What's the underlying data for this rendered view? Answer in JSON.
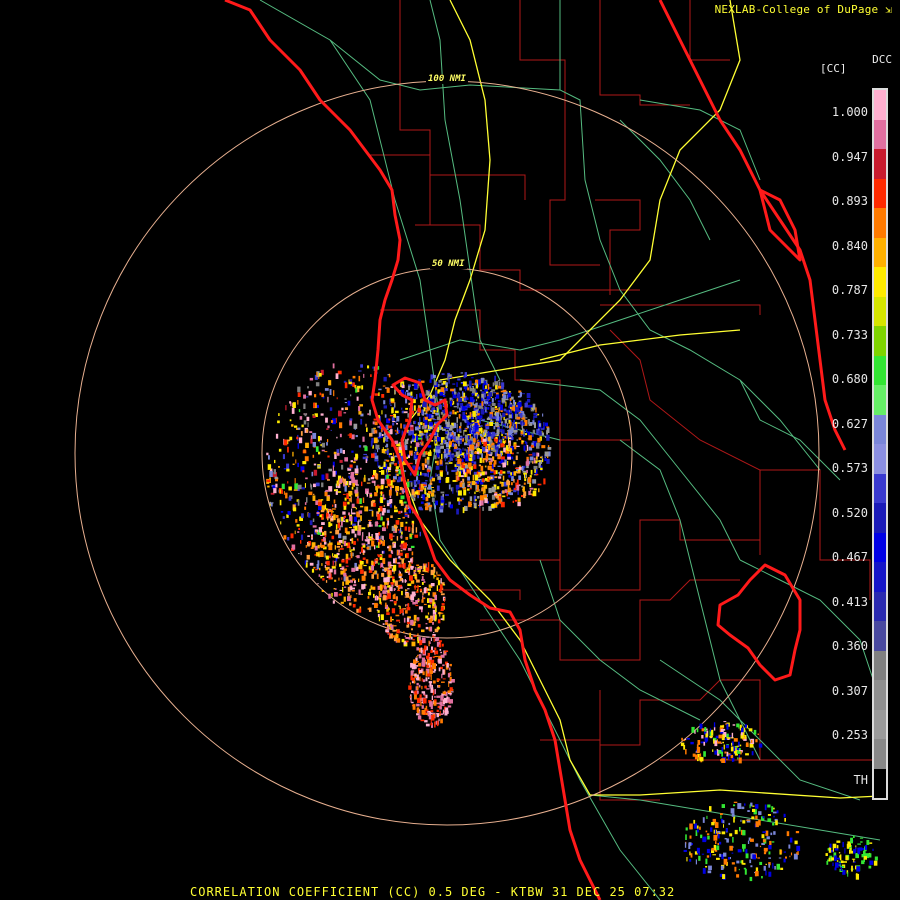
{
  "header": {
    "credit": "NEXLAB-College of DuPage",
    "credit_icon": "launch-icon"
  },
  "footer": {
    "title": "CORRELATION COEFFICIENT (CC) 0.5 DEG - KTBW 31 DEC 25 07:32"
  },
  "rings": {
    "inner_label": "50 NMI",
    "outer_label": "100 NMI"
  },
  "legend": {
    "product": "DCC",
    "units": "[CC]",
    "ticks": [
      "1.000",
      "0.947",
      "0.893",
      "0.840",
      "0.787",
      "0.733",
      "0.680",
      "0.627",
      "0.573",
      "0.520",
      "0.467",
      "0.413",
      "0.360",
      "0.307",
      "0.253",
      "TH"
    ],
    "colors": [
      "#ffb0d0",
      "#e070a0",
      "#c81b2e",
      "#ff2a00",
      "#ff7a00",
      "#ffb000",
      "#ffea00",
      "#d6e600",
      "#7fd300",
      "#33e633",
      "#66ee66",
      "#7a86d8",
      "#8b8fe0",
      "#3a3ad0",
      "#1a1ab8",
      "#0000e6",
      "#1515c8",
      "#2a2ab0",
      "#4a4aa0",
      "#808080",
      "#8f8f8f",
      "#9a9a9a",
      "#888888",
      "#000000"
    ]
  },
  "colors": {
    "background": "#000000",
    "state_border": "#ff1a1a",
    "county_border": "#b01818",
    "highway": "#ffff33",
    "roads": "#66cc88",
    "range_ring": "#e8b090",
    "text": "#ffff33"
  }
}
